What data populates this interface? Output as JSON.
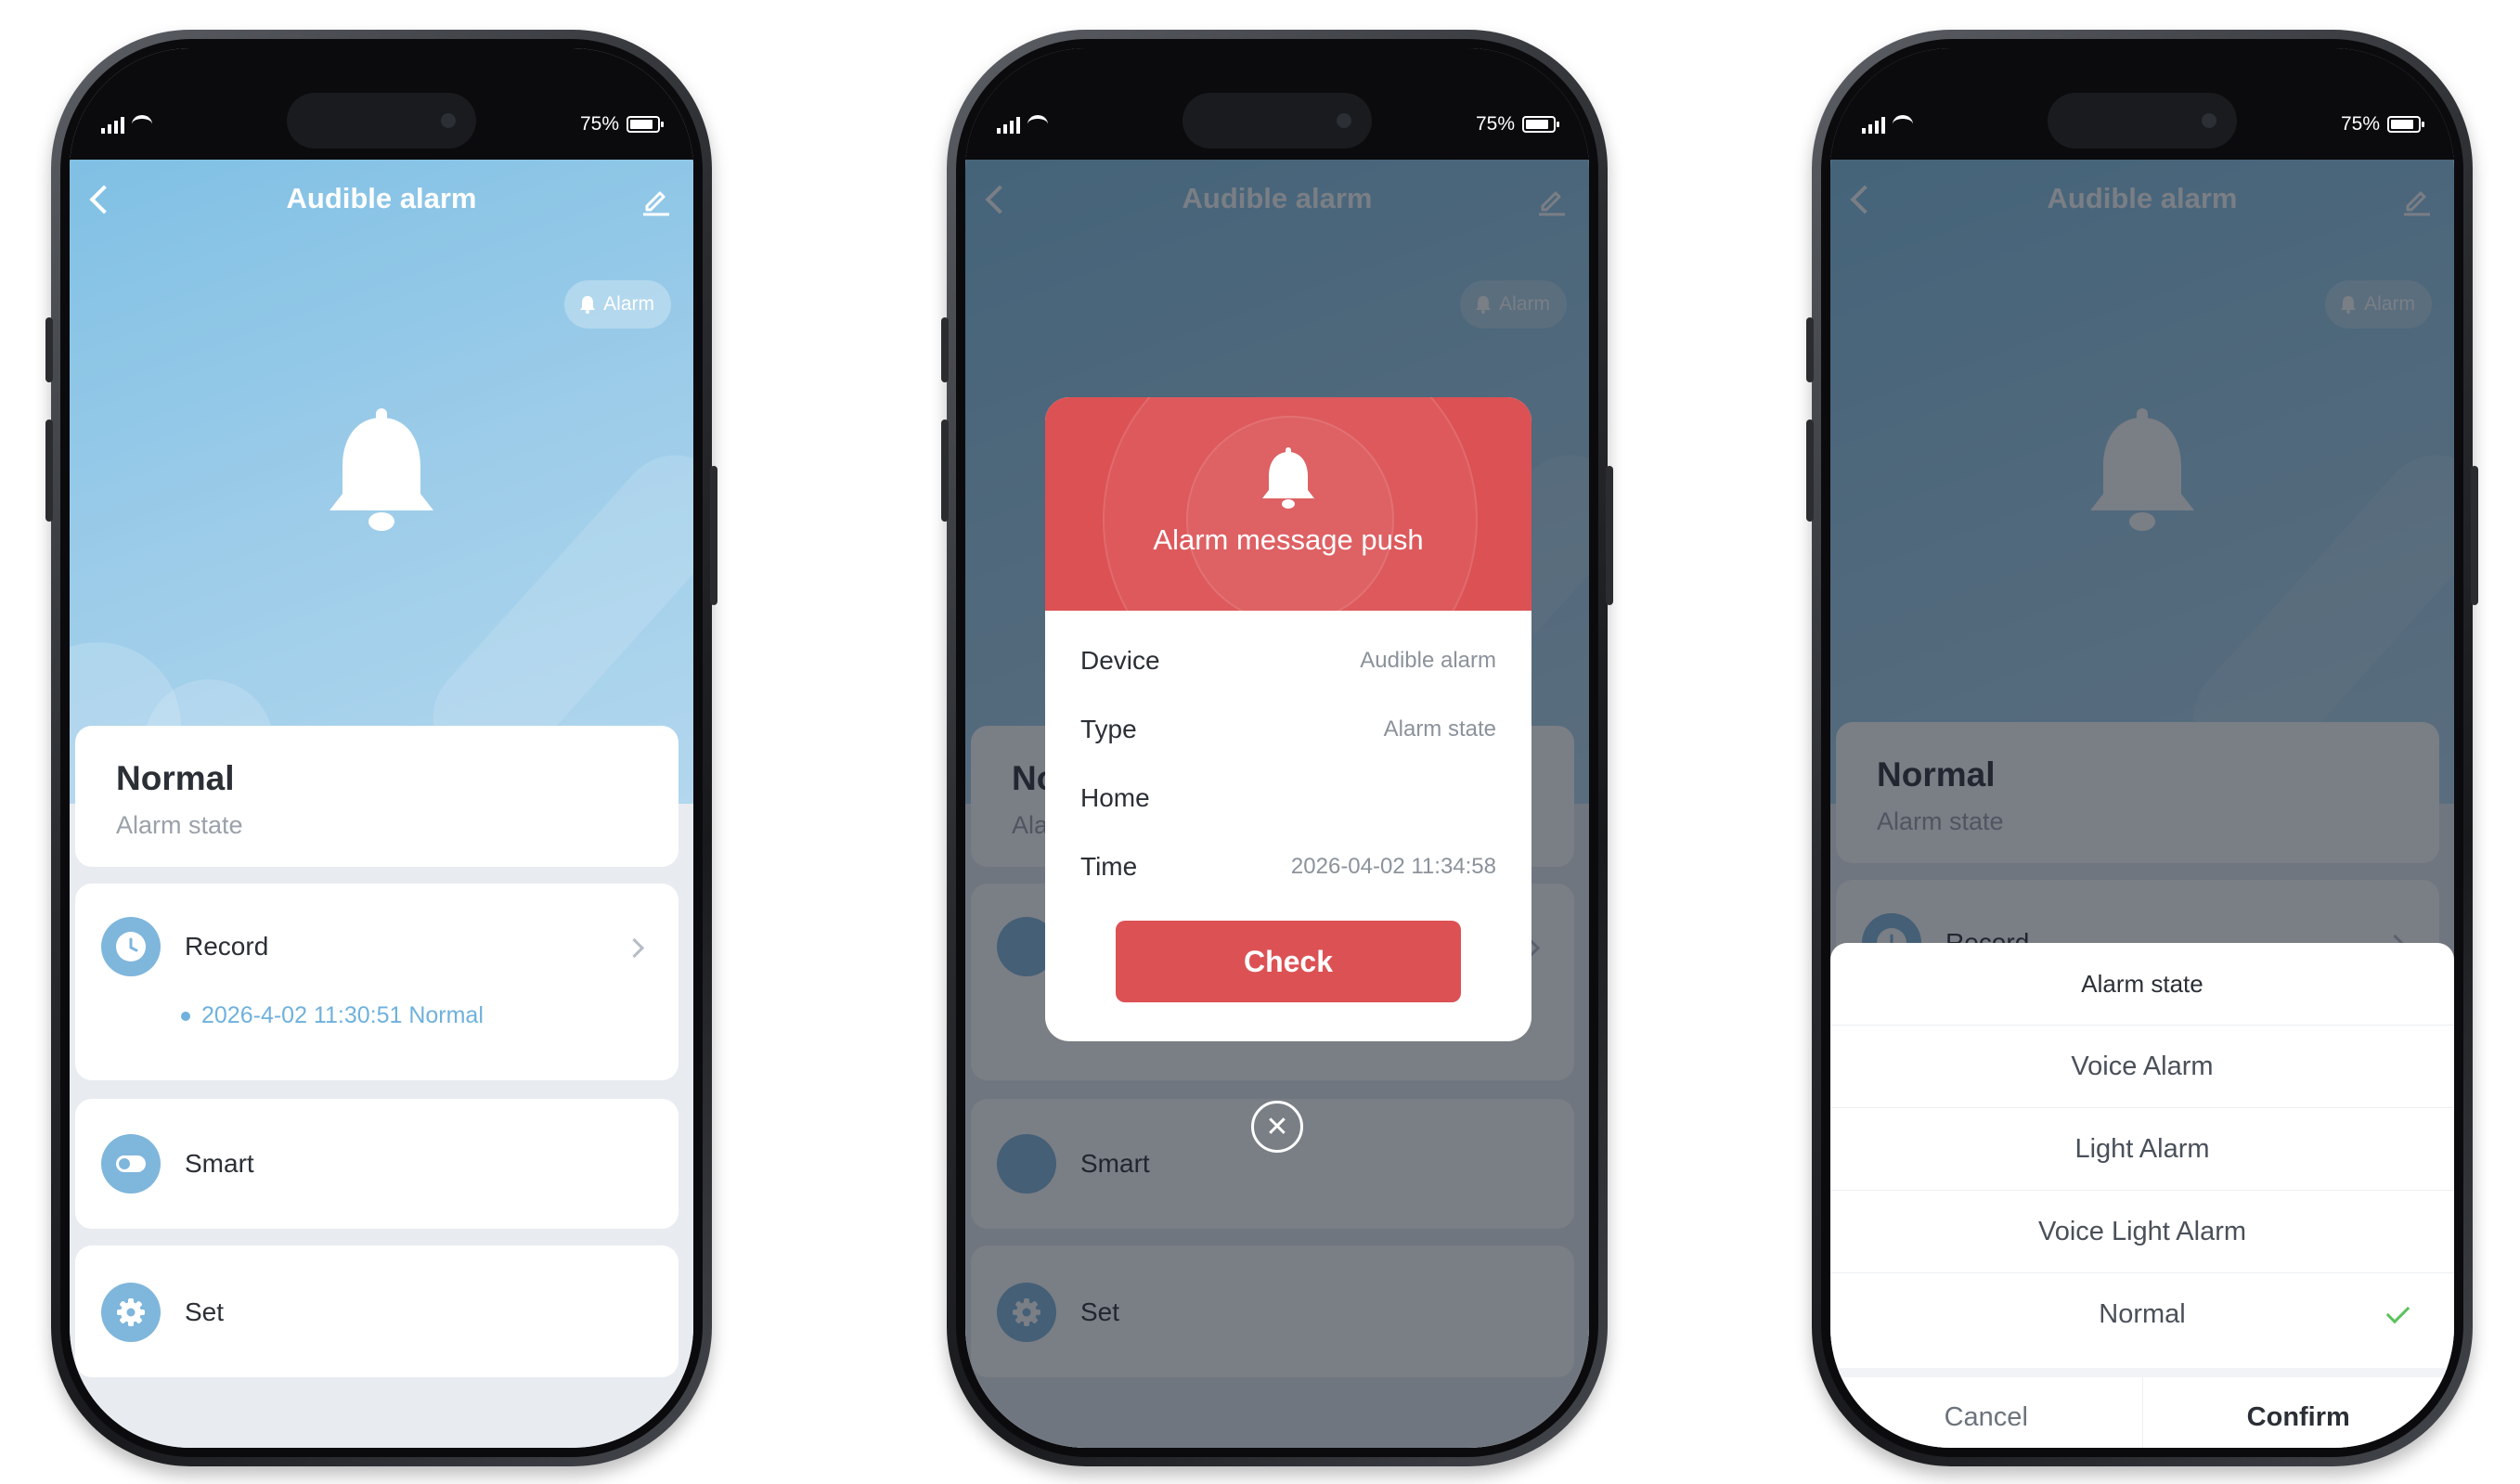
{
  "colors": {
    "hero_blue": "#8fc6e6",
    "accent_blue": "#6fb1dc",
    "alarm_red": "#dc5154",
    "check_green": "#5cc25c"
  },
  "status_bar": {
    "battery": "75%"
  },
  "screen": {
    "title": "Audible alarm",
    "alarm_chip": "Alarm",
    "state_value": "Normal",
    "state_label": "Alarm state",
    "record_label": "Record",
    "record_entry": "2026-4-02 11:30:51 Normal",
    "smart_label": "Smart",
    "set_label": "Set"
  },
  "popup": {
    "title": "Alarm message push",
    "rows": [
      {
        "key": "Device",
        "value": "Audible alarm"
      },
      {
        "key": "Type",
        "value": "Alarm state"
      },
      {
        "key": "Home",
        "value": ""
      },
      {
        "key": "Time",
        "value": "2026-04-02 11:34:58"
      }
    ],
    "check_label": "Check",
    "close_glyph": "✕"
  },
  "sheet": {
    "title": "Alarm state",
    "options": [
      "Voice Alarm",
      "Light Alarm",
      "Voice Light Alarm",
      "Normal"
    ],
    "selected": "Normal",
    "cancel_label": "Cancel",
    "confirm_label": "Confirm"
  },
  "icons": {
    "back": "chevron-left-icon",
    "edit": "pencil-icon",
    "bell": "bell-icon",
    "record": "clock-icon",
    "smart": "toggle-icon",
    "set": "gear-icon"
  }
}
